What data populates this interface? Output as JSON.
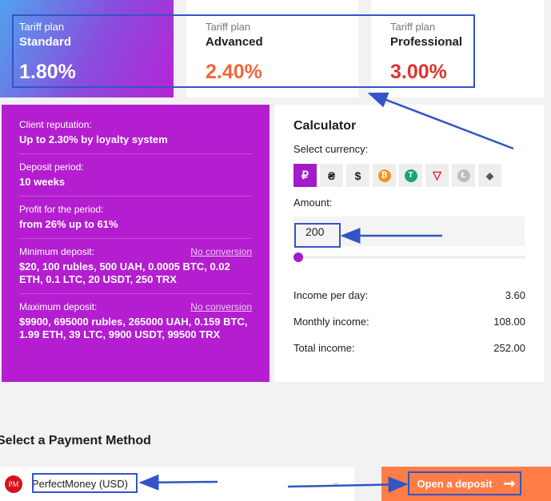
{
  "plans": [
    {
      "caption": "Tariff plan",
      "name": "Standard",
      "rate": "1.80%",
      "color": "#ffffff"
    },
    {
      "caption": "Tariff plan",
      "name": "Advanced",
      "rate": "2.40%",
      "color": "#f0673b"
    },
    {
      "caption": "Tariff plan",
      "name": "Professional",
      "rate": "3.00%",
      "color": "#e0332d"
    }
  ],
  "details": {
    "reputation_label": "Client reputation:",
    "reputation_value": "Up to 2.30% by loyalty system",
    "period_label": "Deposit period:",
    "period_value": "10 weeks",
    "profit_label": "Profit for the period:",
    "profit_value": "from 26% up to 61%",
    "min_label": "Minimum deposit:",
    "min_link": "No conversion",
    "min_value": "$20, 100 rubles, 500 UAH, 0.0005 BTC, 0.02 ETH, 0.1 LTC, 20 USDT, 250 TRX",
    "max_label": "Maximum deposit:",
    "max_link": "No conversion",
    "max_value": "$9900, 695000 rubles, 265000 UAH, 0.159 BTC, 1.99 ETH, 39 LTC, 9900 USDT, 99500 TRX"
  },
  "calculator": {
    "title": "Calculator",
    "currency_label": "Select currency:",
    "currencies": [
      {
        "icon": "ruble-icon",
        "glyph": "₽"
      },
      {
        "icon": "hryvnia-icon",
        "glyph": "₴"
      },
      {
        "icon": "dollar-icon",
        "glyph": "$"
      },
      {
        "icon": "bitcoin-icon",
        "glyph": "₿"
      },
      {
        "icon": "tether-icon",
        "glyph": "T"
      },
      {
        "icon": "tron-icon",
        "glyph": "▽"
      },
      {
        "icon": "litecoin-icon",
        "glyph": "Ł"
      },
      {
        "icon": "ethereum-icon",
        "glyph": "◆"
      }
    ],
    "amount_label": "Amount:",
    "amount_value": "200",
    "slider_fraction": 0.0,
    "income_day_label": "Income per day:",
    "income_day_value": "3.60",
    "monthly_label": "Monthly income:",
    "monthly_value": "108.00",
    "total_label": "Total income:",
    "total_value": "252.00"
  },
  "payment": {
    "title": "Select a Payment Method",
    "logo_text": "PM",
    "selected": "PerfectMoney (USD)",
    "button_label": "Open a deposit"
  },
  "colors": {
    "accent": "#b41ed0",
    "button": "#ff7e47",
    "annotation": "#3255c5"
  }
}
